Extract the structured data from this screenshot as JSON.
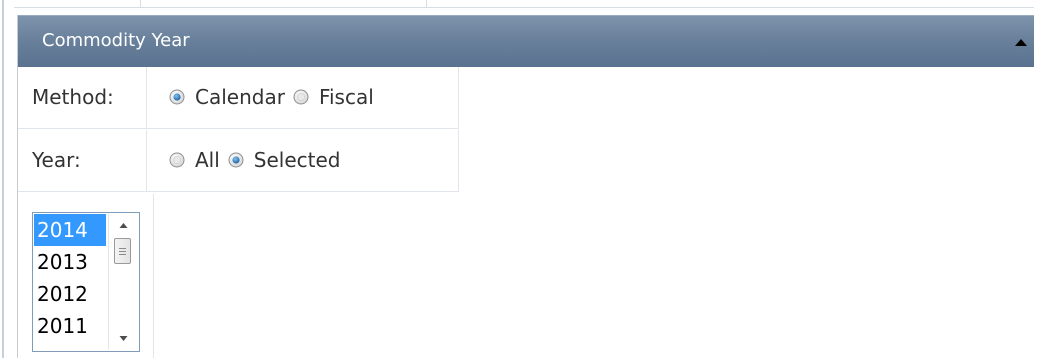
{
  "panel": {
    "title": "Commodity Year"
  },
  "method": {
    "label": "Method:",
    "options": [
      {
        "label": "Calendar",
        "selected": true
      },
      {
        "label": "Fiscal",
        "selected": false
      }
    ]
  },
  "year": {
    "label": "Year:",
    "options": [
      {
        "label": "All",
        "selected": false
      },
      {
        "label": "Selected",
        "selected": true
      }
    ]
  },
  "year_list": {
    "items": [
      "2014",
      "2013",
      "2012",
      "2011"
    ],
    "selected": "2014"
  },
  "colors": {
    "header_bg": "#6a819c",
    "selection": "#3399ff",
    "border": "#e1e6ec"
  },
  "icons": {
    "collapse": "triangle-up-icon",
    "scroll_up": "scroll-up-arrow-icon",
    "scroll_down": "scroll-down-arrow-icon"
  }
}
